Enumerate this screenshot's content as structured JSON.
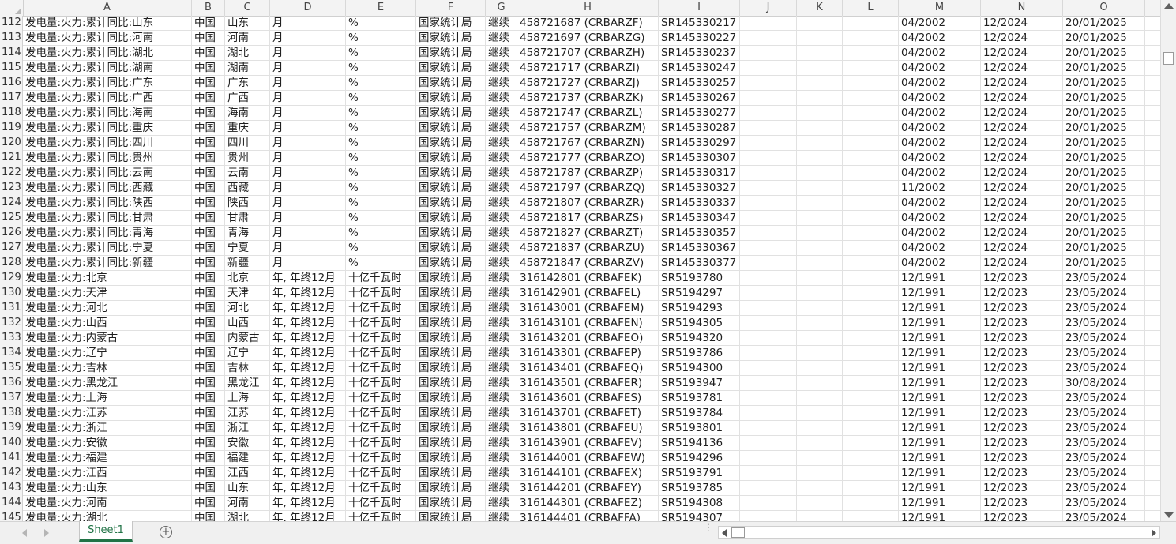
{
  "columns": [
    "A",
    "B",
    "C",
    "D",
    "E",
    "F",
    "G",
    "H",
    "I",
    "J",
    "K",
    "L",
    "M",
    "N",
    "O"
  ],
  "rows": [
    {
      "n": "112",
      "cells": [
        "发电量:火力:累计同比:山东",
        "中国",
        "山东",
        "月",
        "%",
        "国家统计局",
        "继续",
        "458721687 (CRBARZF)",
        "SR145330217",
        "",
        "",
        "",
        "04/2002",
        "12/2024",
        "20/01/2025"
      ]
    },
    {
      "n": "113",
      "cells": [
        "发电量:火力:累计同比:河南",
        "中国",
        "河南",
        "月",
        "%",
        "国家统计局",
        "继续",
        "458721697 (CRBARZG)",
        "SR145330227",
        "",
        "",
        "",
        "04/2002",
        "12/2024",
        "20/01/2025"
      ]
    },
    {
      "n": "114",
      "cells": [
        "发电量:火力:累计同比:湖北",
        "中国",
        "湖北",
        "月",
        "%",
        "国家统计局",
        "继续",
        "458721707 (CRBARZH)",
        "SR145330237",
        "",
        "",
        "",
        "04/2002",
        "12/2024",
        "20/01/2025"
      ]
    },
    {
      "n": "115",
      "cells": [
        "发电量:火力:累计同比:湖南",
        "中国",
        "湖南",
        "月",
        "%",
        "国家统计局",
        "继续",
        "458721717 (CRBARZI)",
        "SR145330247",
        "",
        "",
        "",
        "04/2002",
        "12/2024",
        "20/01/2025"
      ]
    },
    {
      "n": "116",
      "cells": [
        "发电量:火力:累计同比:广东",
        "中国",
        "广东",
        "月",
        "%",
        "国家统计局",
        "继续",
        "458721727 (CRBARZJ)",
        "SR145330257",
        "",
        "",
        "",
        "04/2002",
        "12/2024",
        "20/01/2025"
      ]
    },
    {
      "n": "117",
      "cells": [
        "发电量:火力:累计同比:广西",
        "中国",
        "广西",
        "月",
        "%",
        "国家统计局",
        "继续",
        "458721737 (CRBARZK)",
        "SR145330267",
        "",
        "",
        "",
        "04/2002",
        "12/2024",
        "20/01/2025"
      ]
    },
    {
      "n": "118",
      "cells": [
        "发电量:火力:累计同比:海南",
        "中国",
        "海南",
        "月",
        "%",
        "国家统计局",
        "继续",
        "458721747 (CRBARZL)",
        "SR145330277",
        "",
        "",
        "",
        "04/2002",
        "12/2024",
        "20/01/2025"
      ]
    },
    {
      "n": "119",
      "cells": [
        "发电量:火力:累计同比:重庆",
        "中国",
        "重庆",
        "月",
        "%",
        "国家统计局",
        "继续",
        "458721757 (CRBARZM)",
        "SR145330287",
        "",
        "",
        "",
        "04/2002",
        "12/2024",
        "20/01/2025"
      ]
    },
    {
      "n": "120",
      "cells": [
        "发电量:火力:累计同比:四川",
        "中国",
        "四川",
        "月",
        "%",
        "国家统计局",
        "继续",
        "458721767 (CRBARZN)",
        "SR145330297",
        "",
        "",
        "",
        "04/2002",
        "12/2024",
        "20/01/2025"
      ]
    },
    {
      "n": "121",
      "cells": [
        "发电量:火力:累计同比:贵州",
        "中国",
        "贵州",
        "月",
        "%",
        "国家统计局",
        "继续",
        "458721777 (CRBARZO)",
        "SR145330307",
        "",
        "",
        "",
        "04/2002",
        "12/2024",
        "20/01/2025"
      ]
    },
    {
      "n": "122",
      "cells": [
        "发电量:火力:累计同比:云南",
        "中国",
        "云南",
        "月",
        "%",
        "国家统计局",
        "继续",
        "458721787 (CRBARZP)",
        "SR145330317",
        "",
        "",
        "",
        "04/2002",
        "12/2024",
        "20/01/2025"
      ]
    },
    {
      "n": "123",
      "cells": [
        "发电量:火力:累计同比:西藏",
        "中国",
        "西藏",
        "月",
        "%",
        "国家统计局",
        "继续",
        "458721797 (CRBARZQ)",
        "SR145330327",
        "",
        "",
        "",
        "11/2002",
        "12/2024",
        "20/01/2025"
      ]
    },
    {
      "n": "124",
      "cells": [
        "发电量:火力:累计同比:陕西",
        "中国",
        "陕西",
        "月",
        "%",
        "国家统计局",
        "继续",
        "458721807 (CRBARZR)",
        "SR145330337",
        "",
        "",
        "",
        "04/2002",
        "12/2024",
        "20/01/2025"
      ]
    },
    {
      "n": "125",
      "cells": [
        "发电量:火力:累计同比:甘肃",
        "中国",
        "甘肃",
        "月",
        "%",
        "国家统计局",
        "继续",
        "458721817 (CRBARZS)",
        "SR145330347",
        "",
        "",
        "",
        "04/2002",
        "12/2024",
        "20/01/2025"
      ]
    },
    {
      "n": "126",
      "cells": [
        "发电量:火力:累计同比:青海",
        "中国",
        "青海",
        "月",
        "%",
        "国家统计局",
        "继续",
        "458721827 (CRBARZT)",
        "SR145330357",
        "",
        "",
        "",
        "04/2002",
        "12/2024",
        "20/01/2025"
      ]
    },
    {
      "n": "127",
      "cells": [
        "发电量:火力:累计同比:宁夏",
        "中国",
        "宁夏",
        "月",
        "%",
        "国家统计局",
        "继续",
        "458721837 (CRBARZU)",
        "SR145330367",
        "",
        "",
        "",
        "04/2002",
        "12/2024",
        "20/01/2025"
      ]
    },
    {
      "n": "128",
      "cells": [
        "发电量:火力:累计同比:新疆",
        "中国",
        "新疆",
        "月",
        "%",
        "国家统计局",
        "继续",
        "458721847 (CRBARZV)",
        "SR145330377",
        "",
        "",
        "",
        "04/2002",
        "12/2024",
        "20/01/2025"
      ]
    },
    {
      "n": "129",
      "cells": [
        "发电量:火力:北京",
        "中国",
        "北京",
        "年, 年终12月",
        "十亿千瓦时",
        "国家统计局",
        "继续",
        "316142801 (CRBAFEK)",
        "SR5193780",
        "",
        "",
        "",
        "12/1991",
        "12/2023",
        "23/05/2024"
      ]
    },
    {
      "n": "130",
      "cells": [
        "发电量:火力:天津",
        "中国",
        "天津",
        "年, 年终12月",
        "十亿千瓦时",
        "国家统计局",
        "继续",
        "316142901 (CRBAFEL)",
        "SR5194297",
        "",
        "",
        "",
        "12/1991",
        "12/2023",
        "23/05/2024"
      ]
    },
    {
      "n": "131",
      "cells": [
        "发电量:火力:河北",
        "中国",
        "河北",
        "年, 年终12月",
        "十亿千瓦时",
        "国家统计局",
        "继续",
        "316143001 (CRBAFEM)",
        "SR5194293",
        "",
        "",
        "",
        "12/1991",
        "12/2023",
        "23/05/2024"
      ]
    },
    {
      "n": "132",
      "cells": [
        "发电量:火力:山西",
        "中国",
        "山西",
        "年, 年终12月",
        "十亿千瓦时",
        "国家统计局",
        "继续",
        "316143101 (CRBAFEN)",
        "SR5194305",
        "",
        "",
        "",
        "12/1991",
        "12/2023",
        "23/05/2024"
      ]
    },
    {
      "n": "133",
      "cells": [
        "发电量:火力:内蒙古",
        "中国",
        "内蒙古",
        "年, 年终12月",
        "十亿千瓦时",
        "国家统计局",
        "继续",
        "316143201 (CRBAFEO)",
        "SR5194320",
        "",
        "",
        "",
        "12/1991",
        "12/2023",
        "23/05/2024"
      ]
    },
    {
      "n": "134",
      "cells": [
        "发电量:火力:辽宁",
        "中国",
        "辽宁",
        "年, 年终12月",
        "十亿千瓦时",
        "国家统计局",
        "继续",
        "316143301 (CRBAFEP)",
        "SR5193786",
        "",
        "",
        "",
        "12/1991",
        "12/2023",
        "23/05/2024"
      ]
    },
    {
      "n": "135",
      "cells": [
        "发电量:火力:吉林",
        "中国",
        "吉林",
        "年, 年终12月",
        "十亿千瓦时",
        "国家统计局",
        "继续",
        "316143401 (CRBAFEQ)",
        "SR5194300",
        "",
        "",
        "",
        "12/1991",
        "12/2023",
        "23/05/2024"
      ]
    },
    {
      "n": "136",
      "cells": [
        "发电量:火力:黑龙江",
        "中国",
        "黑龙江",
        "年, 年终12月",
        "十亿千瓦时",
        "国家统计局",
        "继续",
        "316143501 (CRBAFER)",
        "SR5193947",
        "",
        "",
        "",
        "12/1991",
        "12/2023",
        "30/08/2024"
      ]
    },
    {
      "n": "137",
      "cells": [
        "发电量:火力:上海",
        "中国",
        "上海",
        "年, 年终12月",
        "十亿千瓦时",
        "国家统计局",
        "继续",
        "316143601 (CRBAFES)",
        "SR5193781",
        "",
        "",
        "",
        "12/1991",
        "12/2023",
        "23/05/2024"
      ]
    },
    {
      "n": "138",
      "cells": [
        "发电量:火力:江苏",
        "中国",
        "江苏",
        "年, 年终12月",
        "十亿千瓦时",
        "国家统计局",
        "继续",
        "316143701 (CRBAFET)",
        "SR5193784",
        "",
        "",
        "",
        "12/1991",
        "12/2023",
        "23/05/2024"
      ]
    },
    {
      "n": "139",
      "cells": [
        "发电量:火力:浙江",
        "中国",
        "浙江",
        "年, 年终12月",
        "十亿千瓦时",
        "国家统计局",
        "继续",
        "316143801 (CRBAFEU)",
        "SR5193801",
        "",
        "",
        "",
        "12/1991",
        "12/2023",
        "23/05/2024"
      ]
    },
    {
      "n": "140",
      "cells": [
        "发电量:火力:安徽",
        "中国",
        "安徽",
        "年, 年终12月",
        "十亿千瓦时",
        "国家统计局",
        "继续",
        "316143901 (CRBAFEV)",
        "SR5194136",
        "",
        "",
        "",
        "12/1991",
        "12/2023",
        "23/05/2024"
      ]
    },
    {
      "n": "141",
      "cells": [
        "发电量:火力:福建",
        "中国",
        "福建",
        "年, 年终12月",
        "十亿千瓦时",
        "国家统计局",
        "继续",
        "316144001 (CRBAFEW)",
        "SR5194296",
        "",
        "",
        "",
        "12/1991",
        "12/2023",
        "23/05/2024"
      ]
    },
    {
      "n": "142",
      "cells": [
        "发电量:火力:江西",
        "中国",
        "江西",
        "年, 年终12月",
        "十亿千瓦时",
        "国家统计局",
        "继续",
        "316144101 (CRBAFEX)",
        "SR5193791",
        "",
        "",
        "",
        "12/1991",
        "12/2023",
        "23/05/2024"
      ]
    },
    {
      "n": "143",
      "cells": [
        "发电量:火力:山东",
        "中国",
        "山东",
        "年, 年终12月",
        "十亿千瓦时",
        "国家统计局",
        "继续",
        "316144201 (CRBAFEY)",
        "SR5193785",
        "",
        "",
        "",
        "12/1991",
        "12/2023",
        "23/05/2024"
      ]
    },
    {
      "n": "144",
      "cells": [
        "发电量:火力:河南",
        "中国",
        "河南",
        "年, 年终12月",
        "十亿千瓦时",
        "国家统计局",
        "继续",
        "316144301 (CRBAFEZ)",
        "SR5194308",
        "",
        "",
        "",
        "12/1991",
        "12/2023",
        "23/05/2024"
      ]
    },
    {
      "n": "145",
      "cells": [
        "发电量:火力:湖北",
        "中国",
        "湖北",
        "年, 年终12月",
        "十亿千瓦时",
        "国家统计局",
        "继续",
        "316144401 (CRBAFFA)",
        "SR5194307",
        "",
        "",
        "",
        "12/1991",
        "12/2023",
        "23/05/2024"
      ]
    }
  ],
  "footer": {
    "sheet_tab_label": "Sheet1",
    "add_sheet_symbol": "+"
  },
  "colors": {
    "accent": "#217346",
    "header_bg": "#f3f3f3",
    "gridline": "#e1e1e1"
  },
  "icons": [
    "add-sheet-icon",
    "scroll-left-icon",
    "scroll-right-icon",
    "scroll-up-icon",
    "scroll-down-icon"
  ]
}
